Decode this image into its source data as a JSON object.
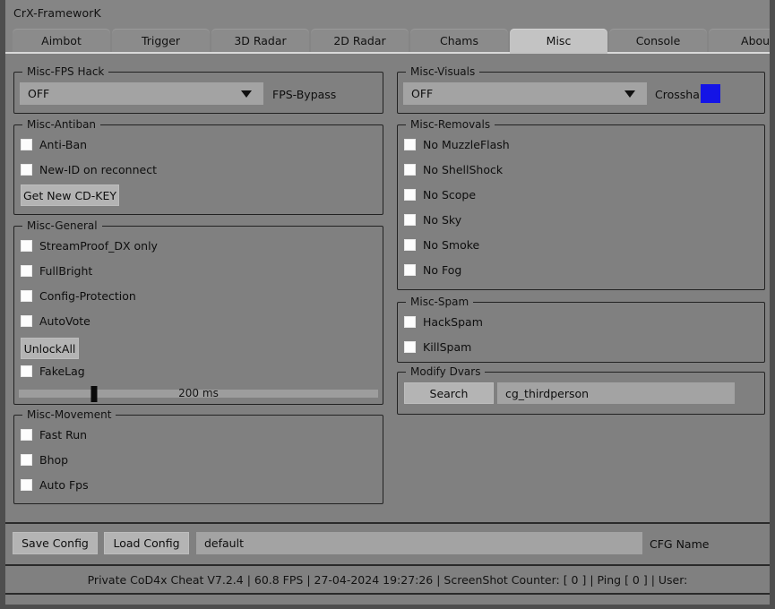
{
  "window": {
    "title": "CrX-FrameworK"
  },
  "tabs": [
    {
      "label": "Aimbot",
      "active": false
    },
    {
      "label": "Trigger",
      "active": false
    },
    {
      "label": "3D Radar",
      "active": false
    },
    {
      "label": "2D Radar",
      "active": false
    },
    {
      "label": "Chams",
      "active": false
    },
    {
      "label": "Misc",
      "active": true
    },
    {
      "label": "Console",
      "active": false
    },
    {
      "label": "About",
      "active": false
    }
  ],
  "groups": {
    "fps_hack": {
      "legend": "Misc-FPS Hack",
      "combo_value": "OFF",
      "side_label": "FPS-Bypass"
    },
    "antiban": {
      "legend": "Misc-Antiban",
      "checks": [
        {
          "label": "Anti-Ban",
          "checked": false
        },
        {
          "label": "New-ID on reconnect",
          "checked": false
        }
      ],
      "button": "Get New CD-KEY"
    },
    "general": {
      "legend": "Misc-General",
      "checks": [
        {
          "label": "StreamProof_DX only",
          "checked": false
        },
        {
          "label": "FullBright",
          "checked": false
        },
        {
          "label": "Config-Protection",
          "checked": false
        },
        {
          "label": "AutoVote",
          "checked": false
        }
      ],
      "button": "UnlockAll",
      "fakelag": {
        "label": "FakeLag",
        "checked": false
      },
      "slider": {
        "value_label": "200 ms",
        "percent": 21
      }
    },
    "movement": {
      "legend": "Misc-Movement",
      "checks": [
        {
          "label": "Fast Run",
          "checked": false
        },
        {
          "label": "Bhop",
          "checked": false
        },
        {
          "label": "Auto Fps",
          "checked": false
        }
      ]
    },
    "visuals": {
      "legend": "Misc-Visuals",
      "combo_value": "OFF",
      "side_label": "Crosshair",
      "swatch_color": "#1414e6"
    },
    "removals": {
      "legend": "Misc-Removals",
      "checks": [
        {
          "label": "No MuzzleFlash",
          "checked": false
        },
        {
          "label": "No ShellShock",
          "checked": false
        },
        {
          "label": "No Scope",
          "checked": false
        },
        {
          "label": "No Sky",
          "checked": false
        },
        {
          "label": "No Smoke",
          "checked": false
        },
        {
          "label": "No Fog",
          "checked": false
        }
      ]
    },
    "spam": {
      "legend": "Misc-Spam",
      "checks": [
        {
          "label": "HackSpam",
          "checked": false
        },
        {
          "label": "KillSpam",
          "checked": false
        }
      ]
    },
    "dvars": {
      "legend": "Modify Dvars",
      "button": "Search",
      "field_value": "cg_thirdperson"
    }
  },
  "footer": {
    "save_button": "Save Config",
    "load_button": "Load Config",
    "cfg_value": "default",
    "cfg_label": "CFG Name"
  },
  "status": {
    "text": "Private CoD4x Cheat V7.2.4  | 60.8 FPS |  27-04-2024 19:27:26  | ScreenShot Counter: [ 0 ] | Ping [ 0 ] | User:"
  }
}
